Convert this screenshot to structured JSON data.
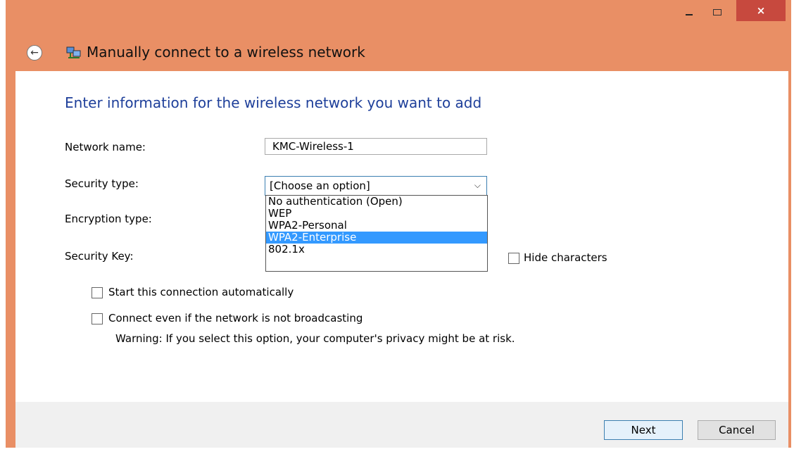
{
  "window": {
    "title": "Manually connect to a wireless network",
    "close_glyph": "×"
  },
  "back_glyph": "←",
  "heading": "Enter information for the wireless network you want to add",
  "form": {
    "network_name_label": "Network name:",
    "network_name_value": "KMC-Wireless-1",
    "security_type_label": "Security type:",
    "security_type_value": "[Choose an option]",
    "security_options": [
      "No authentication (Open)",
      "WEP",
      "WPA2-Personal",
      "WPA2-Enterprise",
      "802.1x"
    ],
    "highlighted_option": "WPA2-Enterprise",
    "encryption_type_label": "Encryption type:",
    "security_key_label": "Security Key:",
    "hide_characters_label": "Hide characters",
    "start_automatically_label": "Start this connection automatically",
    "connect_even_label": "Connect even if the network is not broadcasting",
    "warning": "Warning: If you select this option, your computer's privacy might be at risk."
  },
  "buttons": {
    "next": "Next",
    "cancel": "Cancel"
  },
  "colors": {
    "window_frame": "#e98f65",
    "heading": "#1e3f9a",
    "selection": "#3399ff",
    "close_button": "#c7493e"
  }
}
